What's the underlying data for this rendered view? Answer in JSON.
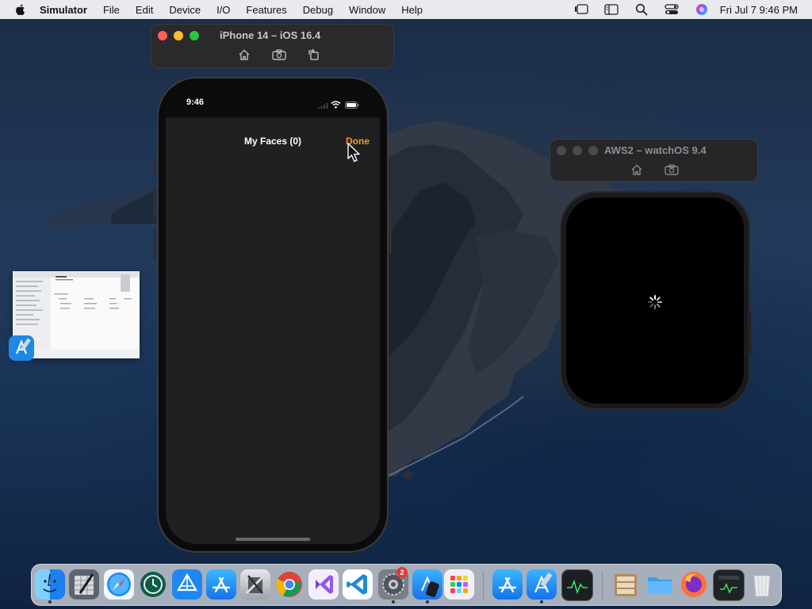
{
  "menubar": {
    "app_name": "Simulator",
    "menus": [
      "File",
      "Edit",
      "Device",
      "I/O",
      "Features",
      "Debug",
      "Window",
      "Help"
    ],
    "clock": "Fri Jul 7  9:46 PM",
    "status_icons": [
      "stage-manager-icon",
      "sidebar-icon",
      "spotlight-search-icon",
      "control-center-icon",
      "siri-icon"
    ]
  },
  "iphone_window": {
    "title": "iPhone 14 – iOS 16.4",
    "toolbar": [
      "home-icon",
      "screenshot-icon",
      "rotate-icon"
    ]
  },
  "iphone_screen": {
    "status_time": "9:46",
    "nav_title": "My Faces (0)",
    "done_label": "Done",
    "done_color": "#F29B1D"
  },
  "watch_window": {
    "title": "AWS2 – watchOS 9.4",
    "toolbar": [
      "home-icon",
      "screenshot-icon"
    ]
  },
  "watch_screen": {
    "state": "loading-spinner-icon"
  },
  "dock": {
    "apps": [
      {
        "name": "finder-icon",
        "running": true
      },
      {
        "name": "script-editor-icon",
        "running": false
      },
      {
        "name": "safari-icon",
        "running": false
      },
      {
        "name": "time-machine-icon",
        "running": false
      },
      {
        "name": "transporter-icon",
        "running": false
      },
      {
        "name": "app-store-icon",
        "running": false
      },
      {
        "name": "system-utility-icon",
        "running": false
      },
      {
        "name": "chrome-icon",
        "running": false
      },
      {
        "name": "visual-studio-icon",
        "running": false
      },
      {
        "name": "vscode-icon",
        "running": false
      },
      {
        "name": "system-preferences-icon",
        "running": true,
        "badge": "2"
      },
      {
        "name": "simulator-icon",
        "running": true
      },
      {
        "name": "launchpad-icon",
        "running": false
      },
      {
        "name": "app-store-connect-icon",
        "running": false
      },
      {
        "name": "xcode-icon",
        "running": true
      },
      {
        "name": "activity-monitor-icon",
        "running": false
      },
      {
        "name": "archive-utility-icon",
        "running": false
      },
      {
        "name": "folder-icon",
        "running": false
      },
      {
        "name": "firefox-icon",
        "running": false
      },
      {
        "name": "console-icon",
        "running": false
      },
      {
        "name": "trash-icon",
        "running": false
      }
    ]
  }
}
